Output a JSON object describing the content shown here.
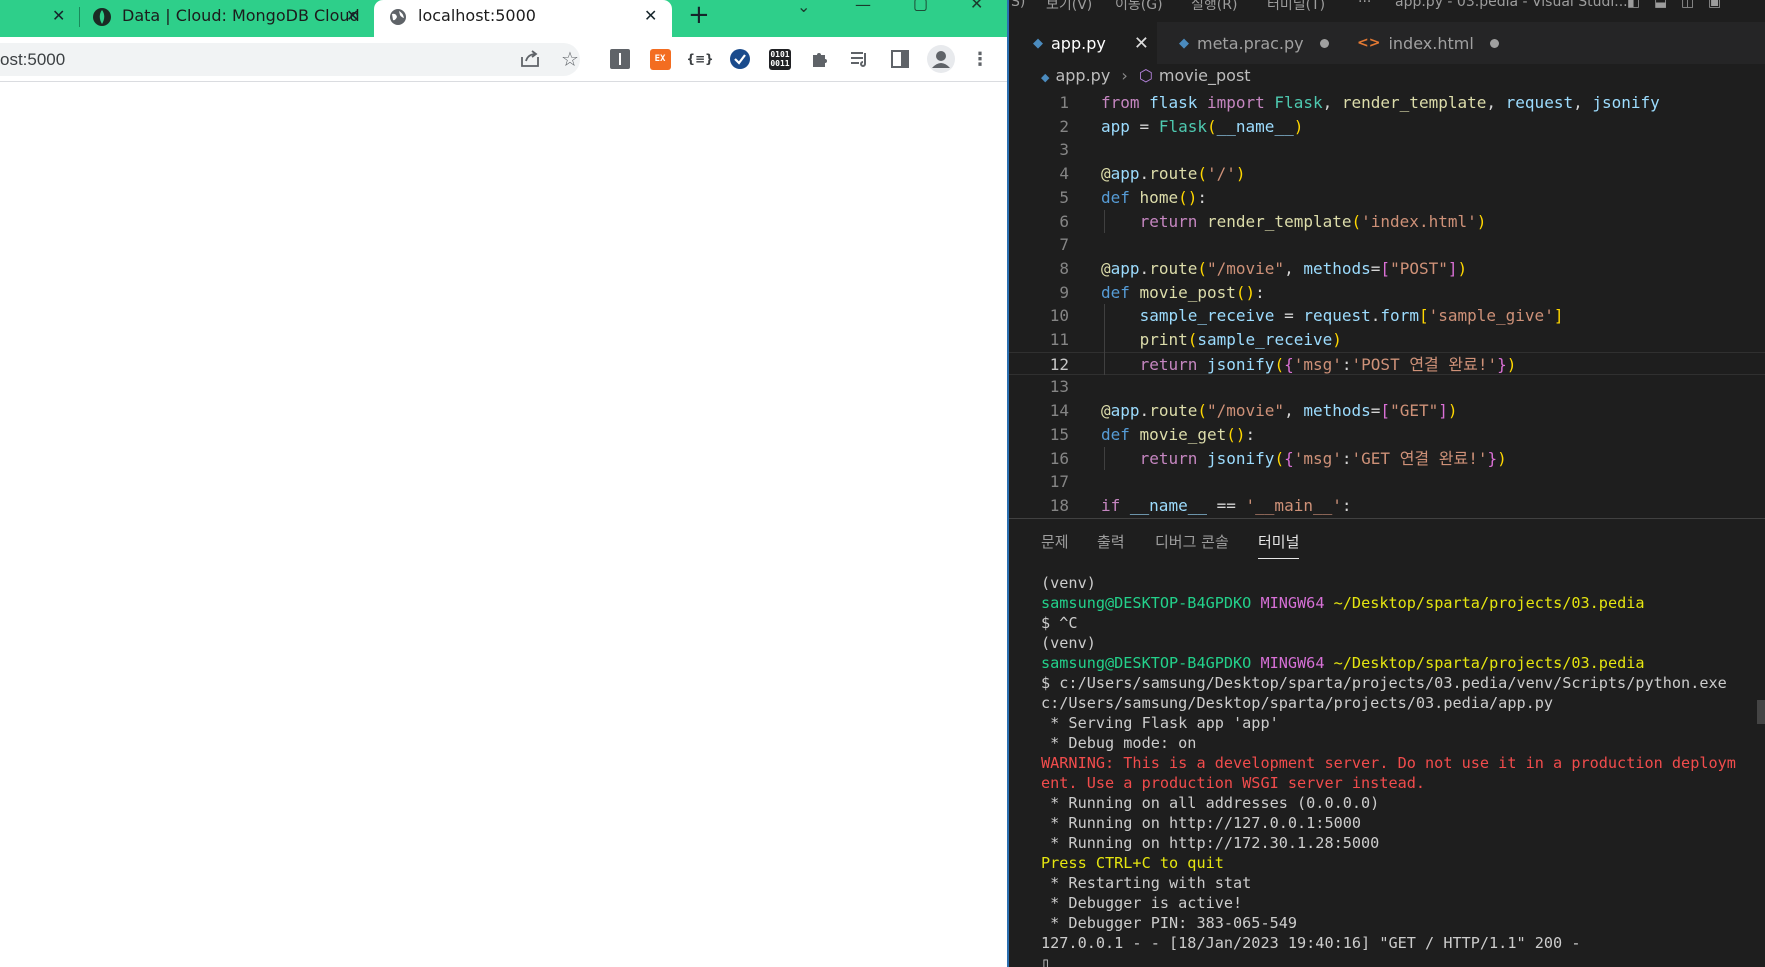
{
  "browser": {
    "tabs": [
      {
        "title": "",
        "close": "✕"
      },
      {
        "title": "Data | Cloud: MongoDB Cloud",
        "close": "✕"
      },
      {
        "title": "localhost:5000",
        "close": "✕",
        "active": true
      }
    ],
    "new_tab": "+",
    "url": "ost:5000",
    "extensions": {
      "ex_label": "EX",
      "json_label": "{≡}",
      "binary_label": "0101\n0011"
    }
  },
  "vscode": {
    "menu": [
      "S)",
      "보기(V)",
      "이동(G)",
      "실행(R)",
      "터미널(T)",
      "···",
      "app.py - 03.pedia - Visual Studi..."
    ],
    "tabs": [
      {
        "label": "app.py",
        "active": true
      },
      {
        "label": "meta.prac.py",
        "modified": true
      },
      {
        "label": "index.html",
        "modified": true
      }
    ],
    "breadcrumb": {
      "file": "app.py",
      "symbol": "movie_post"
    },
    "current_line": 12,
    "code_lines": [
      "from flask import Flask, render_template, request, jsonify",
      "app = Flask(__name__)",
      "",
      "@app.route('/')",
      "def home():",
      "    return render_template('index.html')",
      "",
      "@app.route(\"/movie\", methods=[\"POST\"])",
      "def movie_post():",
      "    sample_receive = request.form['sample_give']",
      "    print(sample_receive)",
      "    return jsonify({'msg':'POST 연결 완료!'})",
      "",
      "@app.route(\"/movie\", methods=[\"GET\"])",
      "def movie_get():",
      "    return jsonify({'msg':'GET 연결 완료!'})",
      "",
      "if __name__ == '__main__':"
    ],
    "panel_tabs": [
      "문제",
      "출력",
      "디버그 콘솔",
      "터미널"
    ],
    "active_panel_tab": "터미널",
    "terminal": {
      "venv": "(venv)",
      "user": "samsung@DESKTOP-B4GPDKO",
      "shell": "MINGW64",
      "cwd": "~/Desktop/sparta/projects/03.pedia",
      "ctrl_c": "$ ^C",
      "cmd1": "$ c:/Users/samsung/Desktop/sparta/projects/03.pedia/venv/Scripts/python.exe",
      "cmd2": "c:/Users/samsung/Desktop/sparta/projects/03.pedia/app.py",
      "serving": " * Serving Flask app 'app'",
      "debug_mode": " * Debug mode: on",
      "warning1": "WARNING: This is a development server. Do not use it in a production deploym",
      "warning2": "ent. Use a production WSGI server instead.",
      "run_all": " * Running on all addresses (0.0.0.0)",
      "run_local": " * Running on http://127.0.0.1:5000",
      "run_lan": " * Running on http://172.30.1.28:5000",
      "quit": "Press CTRL+C to quit",
      "restart": " * Restarting with stat",
      "debugger": " * Debugger is active!",
      "pin": " * Debugger PIN: 383-065-549",
      "request_log": "127.0.0.1 - - [18/Jan/2023 19:40:16] \"GET / HTTP/1.1\" 200 -",
      "cursor": "▯"
    }
  }
}
